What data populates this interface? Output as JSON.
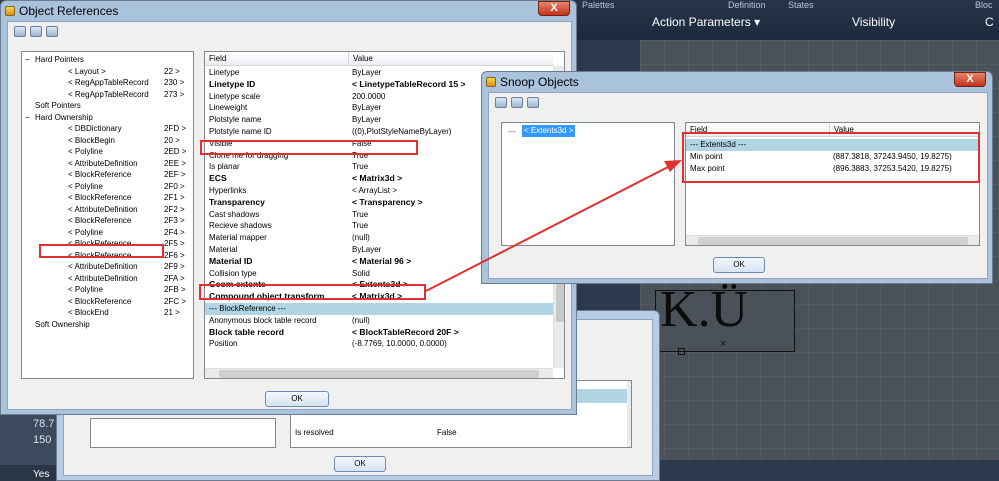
{
  "background_app": {
    "tabs": [
      "Palettes",
      "Definition",
      "States",
      "Bloc"
    ],
    "bar": [
      "Action Parameters",
      "Visibility",
      "C"
    ],
    "left_values": [
      "78.7",
      "150",
      "Yes"
    ],
    "canvas_text": "K.Ü"
  },
  "behind_window": {
    "rows": [
      {
        "field": "Is resolved",
        "value": "False"
      }
    ],
    "ok": "OK"
  },
  "object_references": {
    "title": "Object References",
    "close": "X",
    "ok": "OK",
    "tree": [
      {
        "t": "Hard Pointers",
        "lvl": 0,
        "exp": "−"
      },
      {
        "t": "< Layout >",
        "id": "22 >",
        "lvl": 1
      },
      {
        "t": "< RegAppTableRecord",
        "id": "230 >",
        "lvl": 1
      },
      {
        "t": "< RegAppTableRecord",
        "id": "273 >",
        "lvl": 1
      },
      {
        "t": "Soft Pointers",
        "lvl": 0
      },
      {
        "t": "Hard Ownership",
        "lvl": 0,
        "exp": "−"
      },
      {
        "t": "< DBDictionary",
        "id": "2FD >",
        "lvl": 1
      },
      {
        "t": "< BlockBegin",
        "id": "20 >",
        "lvl": 1
      },
      {
        "t": "< Polyline",
        "id": "2ED >",
        "lvl": 1
      },
      {
        "t": "< AttributeDefinition",
        "id": "2EE >",
        "lvl": 1
      },
      {
        "t": "< BlockReference",
        "id": "2EF >",
        "lvl": 1
      },
      {
        "t": "< Polyline",
        "id": "2F0 >",
        "lvl": 1
      },
      {
        "t": "< BlockReference",
        "id": "2F1 >",
        "lvl": 1
      },
      {
        "t": "< AttributeDefinition",
        "id": "2F2 >",
        "lvl": 1
      },
      {
        "t": "< BlockReference",
        "id": "2F3 >",
        "lvl": 1
      },
      {
        "t": "< Polyline",
        "id": "2F4 >",
        "lvl": 1
      },
      {
        "t": "< BlockReference",
        "id": "2F5 >",
        "lvl": 1
      },
      {
        "t": "< BlockReference",
        "id": "2F6 >",
        "lvl": 1
      },
      {
        "t": "< AttributeDefinition",
        "id": "2F9 >",
        "lvl": 1
      },
      {
        "t": "< AttributeDefinition",
        "id": "2FA >",
        "lvl": 1
      },
      {
        "t": "< Polyline",
        "id": "2FB >",
        "lvl": 1
      },
      {
        "t": "< BlockReference",
        "id": "2FC >",
        "lvl": 1
      },
      {
        "t": "< BlockEnd",
        "id": "21 >",
        "lvl": 1
      },
      {
        "t": "Soft Ownership",
        "lvl": 0
      }
    ],
    "grid_headers": [
      "Field",
      "Value"
    ],
    "rows": [
      {
        "f": "Linetype",
        "v": "ByLayer"
      },
      {
        "f": "Linetype ID",
        "v": "< LinetypeTableRecord       15 >",
        "b": true
      },
      {
        "f": "Linetype scale",
        "v": "200.0000"
      },
      {
        "f": "Lineweight",
        "v": "ByLayer"
      },
      {
        "f": "Plotstyle name",
        "v": "ByLayer"
      },
      {
        "f": "Plotstyle name ID",
        "v": "((0),PlotStyleNameByLayer)"
      },
      {
        "f": "Visible",
        "v": "False"
      },
      {
        "f": "Clone me for dragging",
        "v": "True"
      },
      {
        "f": "Is planar",
        "v": "True"
      },
      {
        "f": "ECS",
        "v": "< Matrix3d >",
        "b": true
      },
      {
        "f": "Hyperlinks",
        "v": "< ArrayList >"
      },
      {
        "f": "Transparency",
        "v": "< Transparency >",
        "b": true
      },
      {
        "f": "Cast shadows",
        "v": "True"
      },
      {
        "f": "Recieve shadows",
        "v": "True"
      },
      {
        "f": "Material mapper",
        "v": "(null)"
      },
      {
        "f": "Material",
        "v": "ByLayer"
      },
      {
        "f": "Material ID",
        "v": "< Material                96 >",
        "b": true
      },
      {
        "f": "Collision type",
        "v": "Solid"
      },
      {
        "f": "Geom extents",
        "v": "< Extents3d >",
        "b": true
      },
      {
        "f": "Compound object transform",
        "v": "< Matrix3d >",
        "b": true
      },
      {
        "f": "--- BlockReference ---",
        "v": "",
        "sec": true
      },
      {
        "f": "Anonymous block table record",
        "v": "(null)"
      },
      {
        "f": "Block table record",
        "v": "< BlockTableRecord       20F >",
        "b": true
      },
      {
        "f": "Position",
        "v": "(-8.7769, 10.0000, 0.0000)"
      }
    ]
  },
  "snoop_objects": {
    "title": "Snoop Objects",
    "close": "X",
    "ok": "OK",
    "tree_item": "< Extents3d >",
    "tree_prefix": "---",
    "grid_headers": [
      "Field",
      "Value"
    ],
    "rows": [
      {
        "f": "--- Extents3d ---",
        "v": "",
        "sec": true
      },
      {
        "f": "Min point",
        "v": "(887.3818, 37243.9450, 19.8275)"
      },
      {
        "f": "Max point",
        "v": "(896.3883, 37253.5420, 19.8275)"
      }
    ]
  },
  "colors": {
    "highlight": "#e03030",
    "section": "#b1d5e5",
    "selection": "#3399ff"
  }
}
